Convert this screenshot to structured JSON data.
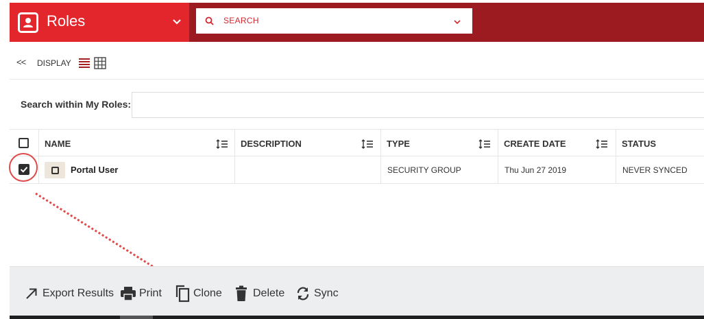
{
  "header": {
    "title": "Roles",
    "title_icon": "contact-card-icon",
    "search": {
      "placeholder": "SEARCH"
    },
    "colors": {
      "roles_bg": "#e3262c",
      "bar_bg": "#9b1b20"
    }
  },
  "toolbar": {
    "back_label": "<<",
    "display_label": "DISPLAY",
    "views": [
      "list-view-icon",
      "grid-view-icon"
    ]
  },
  "filter": {
    "label": "Search within My Roles:",
    "value": ""
  },
  "table": {
    "columns": [
      "NAME",
      "DESCRIPTION",
      "TYPE",
      "CREATE DATE",
      "STATUS"
    ],
    "rows": [
      {
        "selected": true,
        "name": "Portal User",
        "description": "",
        "type": "SECURITY GROUP",
        "create_date": "Thu Jun 27 2019",
        "status": "NEVER SYNCED"
      }
    ]
  },
  "actions": [
    {
      "label": "Export Results",
      "icon": "export-arrow-icon"
    },
    {
      "label": "Print",
      "icon": "printer-icon"
    },
    {
      "label": "Clone",
      "icon": "copy-icon"
    },
    {
      "label": "Delete",
      "icon": "trash-icon"
    },
    {
      "label": "Sync",
      "icon": "sync-icon"
    }
  ],
  "annotation": {
    "color": "#e04a4a"
  }
}
